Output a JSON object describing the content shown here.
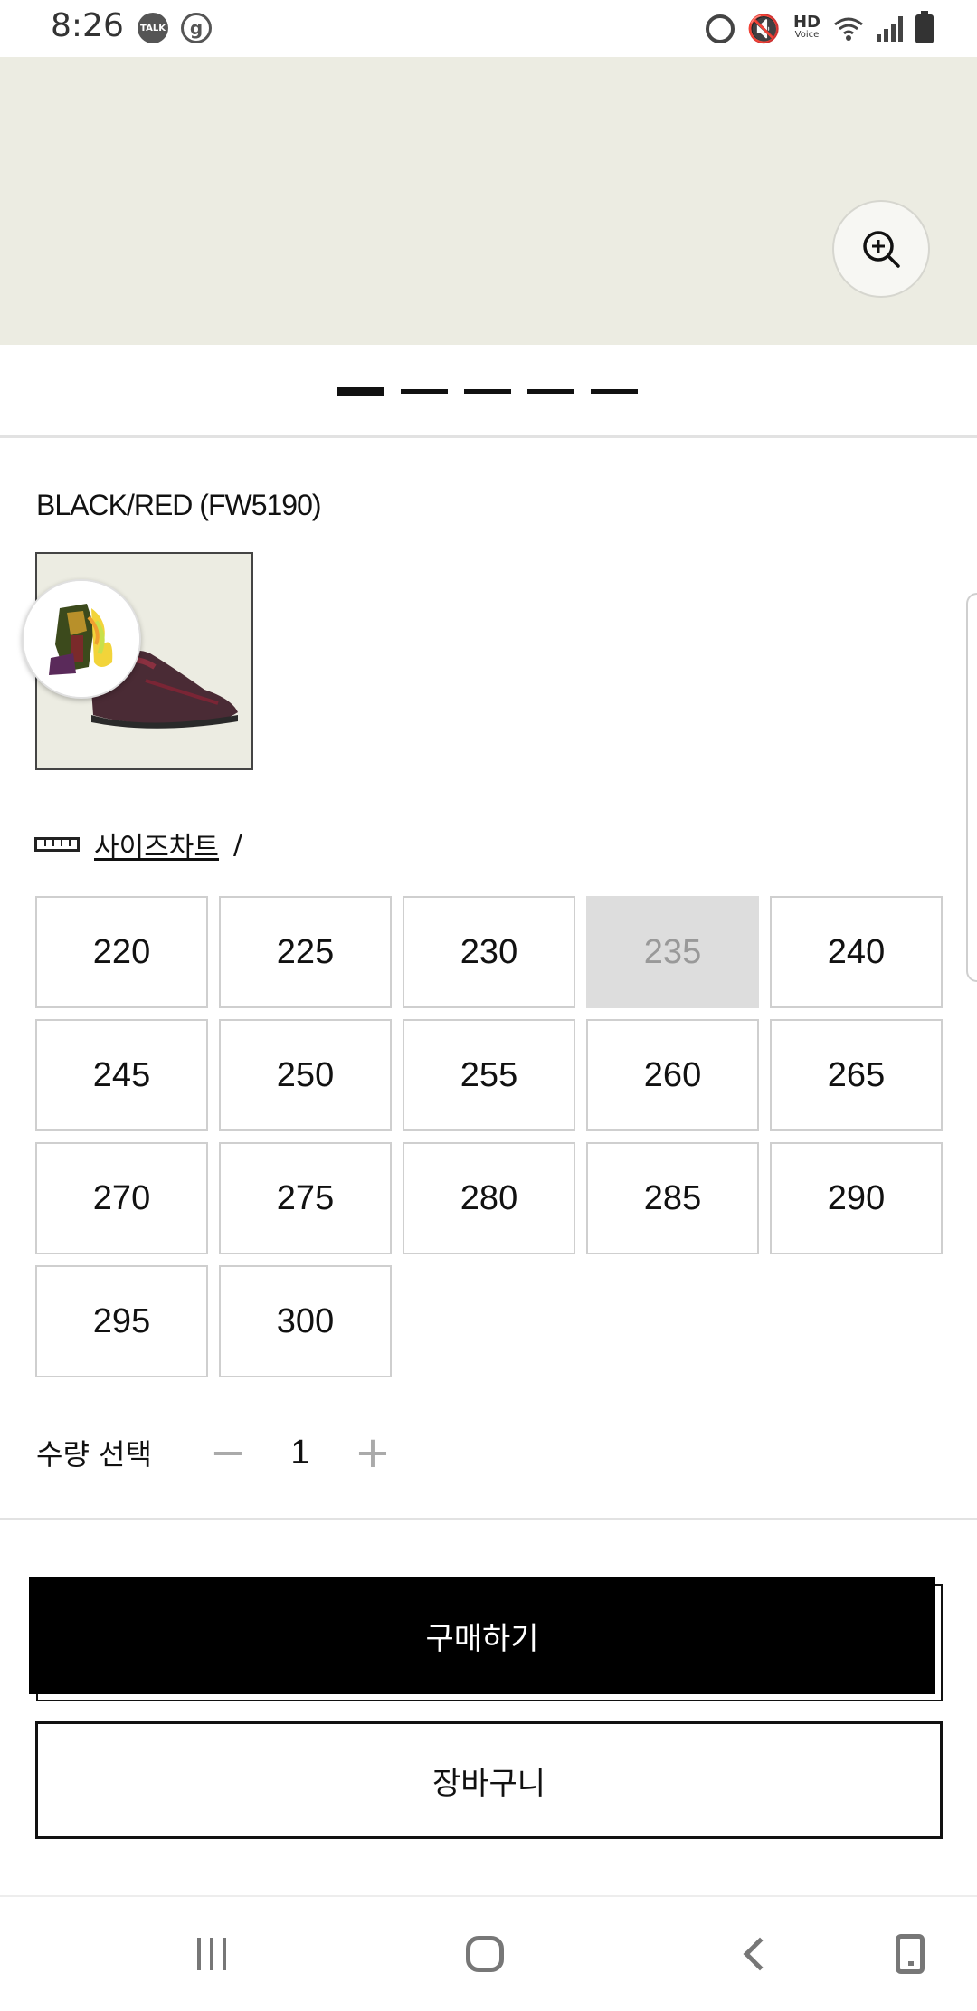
{
  "status_bar": {
    "time": "8:26",
    "talk_badge": "TALK",
    "g_badge": "g",
    "hd_label": "HD",
    "hd_sub": "Voice",
    "icons": [
      "talk-icon",
      "g-icon",
      "alarm-icon",
      "mute-icon",
      "hd-voice-icon",
      "wifi-icon",
      "signal-icon",
      "battery-icon"
    ]
  },
  "hero": {
    "background": "#ecece2",
    "zoom_icon": "zoom-in-icon",
    "pager_count": 5,
    "pager_active_index": 0
  },
  "product": {
    "color_name": "BLACK/RED (FW5190)"
  },
  "size_chart": {
    "link_label": "사이즈차트",
    "separator": "/"
  },
  "sizes": [
    {
      "label": "220",
      "available": true
    },
    {
      "label": "225",
      "available": true
    },
    {
      "label": "230",
      "available": true
    },
    {
      "label": "235",
      "available": false
    },
    {
      "label": "240",
      "available": true
    },
    {
      "label": "245",
      "available": true
    },
    {
      "label": "250",
      "available": true
    },
    {
      "label": "255",
      "available": true
    },
    {
      "label": "260",
      "available": true
    },
    {
      "label": "265",
      "available": true
    },
    {
      "label": "270",
      "available": true
    },
    {
      "label": "275",
      "available": true
    },
    {
      "label": "280",
      "available": true
    },
    {
      "label": "285",
      "available": true
    },
    {
      "label": "290",
      "available": true
    },
    {
      "label": "295",
      "available": true
    },
    {
      "label": "300",
      "available": true
    }
  ],
  "quantity": {
    "label": "수량 선택",
    "minus": "−",
    "value": "1",
    "plus": "+"
  },
  "actions": {
    "buy_label": "구매하기",
    "cart_label": "장바구니"
  },
  "colors": {
    "accent": "#000000",
    "disabled_bg": "#dddddd",
    "disabled_text": "#999999"
  }
}
